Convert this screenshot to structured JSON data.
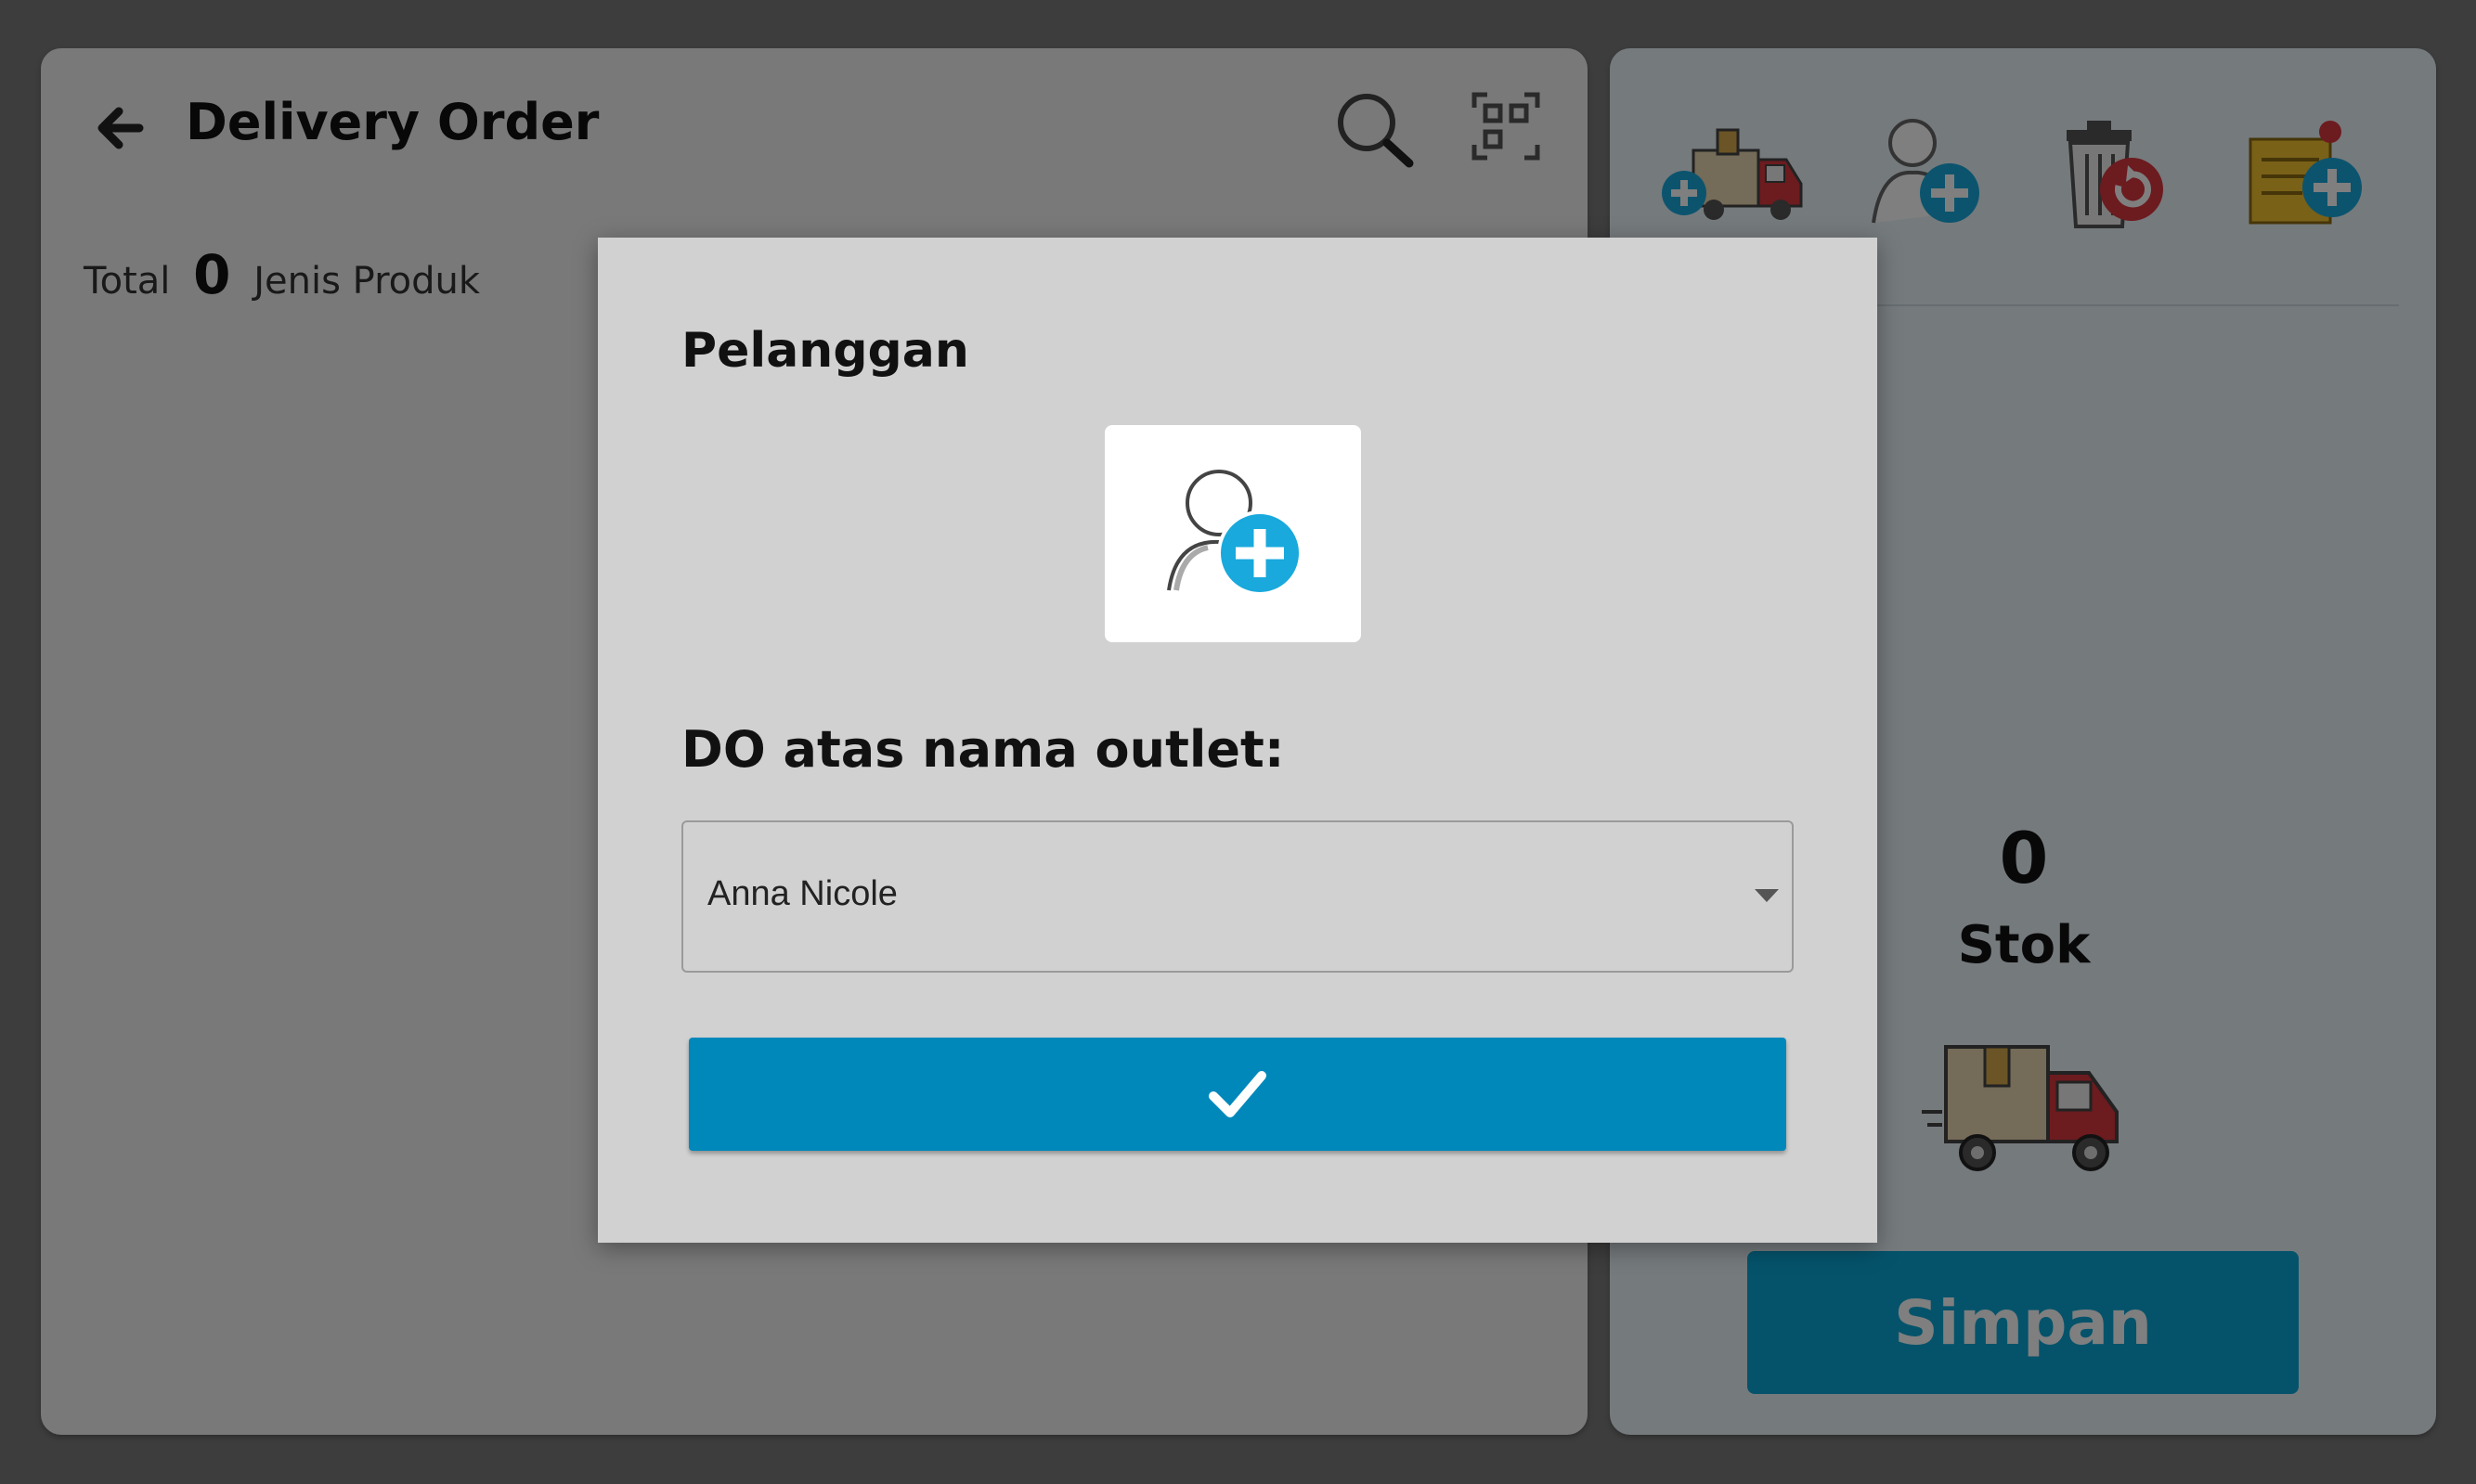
{
  "header": {
    "title": "Delivery Order",
    "icons": [
      "back-arrow-icon",
      "search-icon",
      "scan-icon"
    ]
  },
  "summary": {
    "total_label": "Total",
    "total_count": "0",
    "unit_label": "Jenis Produk"
  },
  "toolbar": {
    "icons": [
      "add-delivery-truck-icon",
      "add-customer-icon",
      "reset-trash-icon",
      "add-note-icon"
    ]
  },
  "stock": {
    "count": "0",
    "label": "Stok"
  },
  "actions": {
    "save_label": "Simpan"
  },
  "modal": {
    "title": "Pelanggan",
    "outlet_label": "DO atas nama outlet:",
    "outlet_selected": "Anna Nicole",
    "confirm_icon": "checkmark-icon"
  },
  "colors": {
    "accent": "#0088bb",
    "save_button": "#0aa6d6",
    "plus_badge": "#19a9dc",
    "truck_red": "#d9363e",
    "box_tan": "#e8d6b0"
  }
}
